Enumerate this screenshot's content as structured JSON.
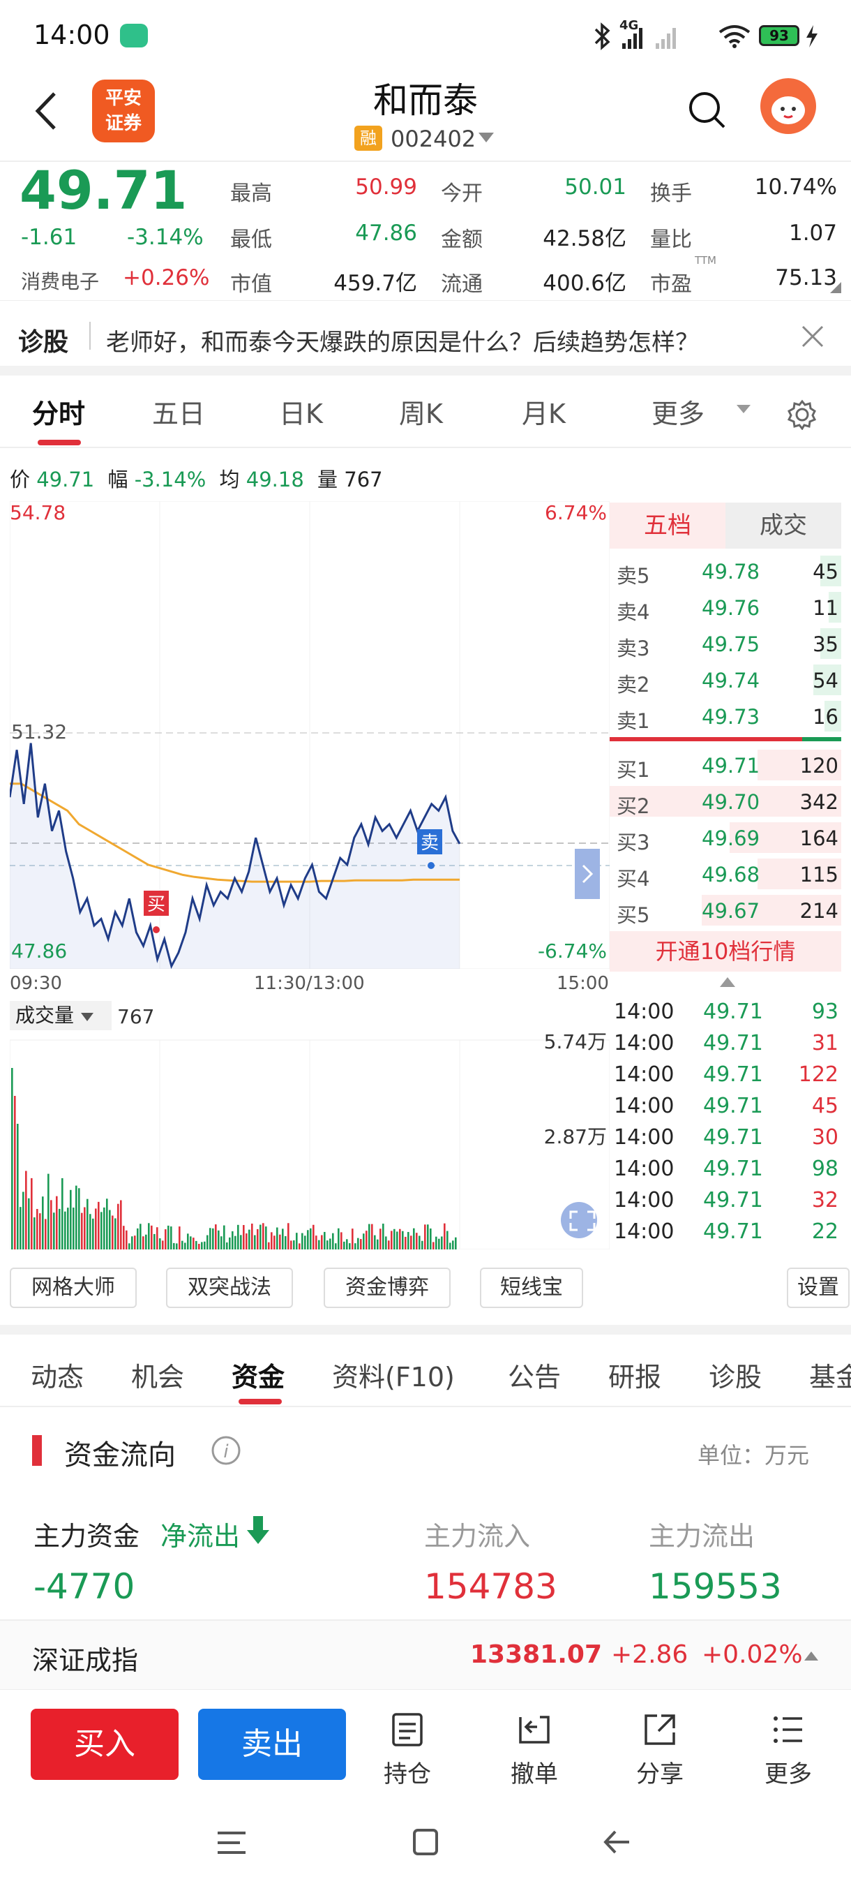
{
  "status": {
    "time": "14:00",
    "network": "4G",
    "battery": "93"
  },
  "header": {
    "logo": "平安\n证券",
    "name": "和而泰",
    "rong": "融",
    "code": "002402"
  },
  "quote": {
    "price": "49.71",
    "change": "-1.61",
    "pct": "-3.14%",
    "sector": "消费电子",
    "sector_pct": "+0.26%",
    "rows": [
      [
        {
          "l": "最高",
          "v": "50.99",
          "c": "red"
        },
        {
          "l": "今开",
          "v": "50.01",
          "c": "green"
        },
        {
          "l": "换手",
          "v": "10.74%",
          "c": "dark"
        }
      ],
      [
        {
          "l": "最低",
          "v": "47.86",
          "c": "green"
        },
        {
          "l": "金额",
          "v": "42.58亿",
          "c": "dark"
        },
        {
          "l": "量比",
          "v": "1.07",
          "c": "dark"
        }
      ],
      [
        {
          "l": "市值",
          "v": "459.7亿",
          "c": "dark"
        },
        {
          "l": "流通",
          "v": "400.6亿",
          "c": "dark"
        },
        {
          "l": "市盈",
          "v": "75.13",
          "c": "dark"
        }
      ]
    ],
    "ttm": "TTM"
  },
  "diag": {
    "label": "诊股",
    "text": "老师好，和而泰今天爆跌的原因是什么？后续趋势怎样？"
  },
  "chart_tabs": [
    "分时",
    "五日",
    "日K",
    "周K",
    "月K",
    "更多"
  ],
  "info_line": {
    "price_l": "价",
    "price": "49.71",
    "amp_l": "幅",
    "amp": "-3.14%",
    "avg_l": "均",
    "avg": "49.18",
    "vol_l": "量",
    "vol": "767"
  },
  "chart_labels": {
    "top_left": "54.78",
    "top_right": "6.74%",
    "mid": "51.32",
    "bottom_left": "47.86",
    "bottom_right": "-6.74%",
    "t_start": "09:30",
    "t_mid": "11:30/13:00",
    "t_end": "15:00",
    "buy_mark": "买",
    "sell_mark": "卖"
  },
  "volume": {
    "label": "成交量",
    "value": "767",
    "max": "5.74万",
    "half": "2.87万"
  },
  "orderbook": {
    "tabs": [
      "五档",
      "成交"
    ],
    "asks": [
      [
        "卖5",
        "49.78",
        "45"
      ],
      [
        "卖4",
        "49.76",
        "11"
      ],
      [
        "卖3",
        "49.75",
        "35"
      ],
      [
        "卖2",
        "49.74",
        "54"
      ],
      [
        "卖1",
        "49.73",
        "16"
      ]
    ],
    "bids": [
      [
        "买1",
        "49.71",
        "120"
      ],
      [
        "买2",
        "49.70",
        "342"
      ],
      [
        "买3",
        "49.69",
        "164"
      ],
      [
        "买4",
        "49.68",
        "115"
      ],
      [
        "买5",
        "49.67",
        "214"
      ]
    ],
    "open10": "开通10档行情"
  },
  "trades": [
    [
      "14:00",
      "49.71",
      "93",
      "green"
    ],
    [
      "14:00",
      "49.71",
      "31",
      "red"
    ],
    [
      "14:00",
      "49.71",
      "122",
      "red"
    ],
    [
      "14:00",
      "49.71",
      "45",
      "red"
    ],
    [
      "14:00",
      "49.71",
      "30",
      "red"
    ],
    [
      "14:00",
      "49.71",
      "98",
      "green"
    ],
    [
      "14:00",
      "49.71",
      "32",
      "red"
    ],
    [
      "14:00",
      "49.71",
      "22",
      "green"
    ]
  ],
  "tools": [
    "网格大师",
    "双突战法",
    "资金博弈",
    "短线宝",
    "设置"
  ],
  "sub_tabs": [
    "动态",
    "机会",
    "资金",
    "资料(F10)",
    "公告",
    "研报",
    "诊股",
    "基金"
  ],
  "fund": {
    "title": "资金流向",
    "unit": "单位：万元",
    "main_l": "主力资金",
    "net_l": "净流出",
    "in_l": "主力流入",
    "out_l": "主力流出",
    "net": "-4770",
    "inflow": "154783",
    "outflow": "159553"
  },
  "index": {
    "name": "深证成指",
    "value": "13381.07",
    "chg": "+2.86",
    "pct": "+0.02%"
  },
  "bottom": {
    "buy": "买入",
    "sell": "卖出",
    "hold": "持仓",
    "cancel": "撤单",
    "share": "分享",
    "more": "更多"
  },
  "chart_data": {
    "type": "line",
    "x_range": [
      "09:30",
      "15:00"
    ],
    "y_range": [
      47.86,
      54.78
    ],
    "ref_price": 51.32,
    "series": [
      {
        "name": "价",
        "values": [
          50.4,
          51.1,
          50.3,
          51.2,
          50.1,
          50.6,
          49.9,
          50.2,
          49.6,
          49.2,
          48.7,
          48.9,
          48.5,
          48.6,
          48.3,
          48.7,
          48.5,
          48.9,
          48.4,
          48.2,
          48.5,
          48.0,
          48.3,
          47.9,
          48.1,
          48.4,
          48.9,
          48.6,
          49.1,
          48.8,
          49.0,
          48.9,
          49.2,
          49.0,
          49.3,
          49.8,
          49.4,
          49.0,
          49.2,
          48.8,
          49.1,
          48.9,
          49.2,
          49.4,
          49.0,
          48.9,
          49.2,
          49.5,
          49.4,
          49.8,
          50.0,
          49.7,
          50.1,
          49.9,
          50.0,
          49.8,
          50.0,
          50.2,
          49.9,
          50.1,
          50.3,
          50.2,
          50.4,
          49.9,
          49.71
        ]
      },
      {
        "name": "均",
        "values": [
          50.6,
          50.6,
          50.5,
          50.4,
          50.3,
          50.2,
          50.0,
          49.9,
          49.8,
          49.7,
          49.6,
          49.5,
          49.4,
          49.35,
          49.3,
          49.25,
          49.22,
          49.2,
          49.18,
          49.17,
          49.16,
          49.15,
          49.15,
          49.15,
          49.15,
          49.15,
          49.15,
          49.16,
          49.16,
          49.16,
          49.17,
          49.17,
          49.17,
          49.17,
          49.17,
          49.18,
          49.18,
          49.18,
          49.18,
          49.18
        ]
      }
    ]
  }
}
